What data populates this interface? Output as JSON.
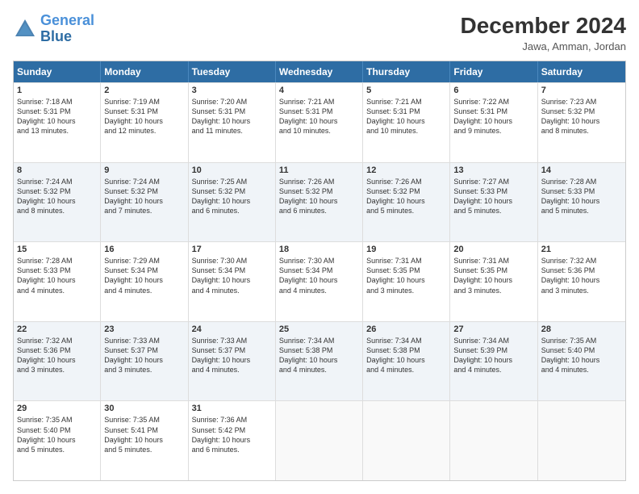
{
  "header": {
    "logo_line1": "General",
    "logo_line2": "Blue",
    "month_title": "December 2024",
    "location": "Jawa, Amman, Jordan"
  },
  "weekdays": [
    "Sunday",
    "Monday",
    "Tuesday",
    "Wednesday",
    "Thursday",
    "Friday",
    "Saturday"
  ],
  "rows": [
    [
      {
        "day": "1",
        "lines": [
          "Sunrise: 7:18 AM",
          "Sunset: 5:31 PM",
          "Daylight: 10 hours",
          "and 13 minutes."
        ]
      },
      {
        "day": "2",
        "lines": [
          "Sunrise: 7:19 AM",
          "Sunset: 5:31 PM",
          "Daylight: 10 hours",
          "and 12 minutes."
        ]
      },
      {
        "day": "3",
        "lines": [
          "Sunrise: 7:20 AM",
          "Sunset: 5:31 PM",
          "Daylight: 10 hours",
          "and 11 minutes."
        ]
      },
      {
        "day": "4",
        "lines": [
          "Sunrise: 7:21 AM",
          "Sunset: 5:31 PM",
          "Daylight: 10 hours",
          "and 10 minutes."
        ]
      },
      {
        "day": "5",
        "lines": [
          "Sunrise: 7:21 AM",
          "Sunset: 5:31 PM",
          "Daylight: 10 hours",
          "and 10 minutes."
        ]
      },
      {
        "day": "6",
        "lines": [
          "Sunrise: 7:22 AM",
          "Sunset: 5:31 PM",
          "Daylight: 10 hours",
          "and 9 minutes."
        ]
      },
      {
        "day": "7",
        "lines": [
          "Sunrise: 7:23 AM",
          "Sunset: 5:32 PM",
          "Daylight: 10 hours",
          "and 8 minutes."
        ]
      }
    ],
    [
      {
        "day": "8",
        "lines": [
          "Sunrise: 7:24 AM",
          "Sunset: 5:32 PM",
          "Daylight: 10 hours",
          "and 8 minutes."
        ]
      },
      {
        "day": "9",
        "lines": [
          "Sunrise: 7:24 AM",
          "Sunset: 5:32 PM",
          "Daylight: 10 hours",
          "and 7 minutes."
        ]
      },
      {
        "day": "10",
        "lines": [
          "Sunrise: 7:25 AM",
          "Sunset: 5:32 PM",
          "Daylight: 10 hours",
          "and 6 minutes."
        ]
      },
      {
        "day": "11",
        "lines": [
          "Sunrise: 7:26 AM",
          "Sunset: 5:32 PM",
          "Daylight: 10 hours",
          "and 6 minutes."
        ]
      },
      {
        "day": "12",
        "lines": [
          "Sunrise: 7:26 AM",
          "Sunset: 5:32 PM",
          "Daylight: 10 hours",
          "and 5 minutes."
        ]
      },
      {
        "day": "13",
        "lines": [
          "Sunrise: 7:27 AM",
          "Sunset: 5:33 PM",
          "Daylight: 10 hours",
          "and 5 minutes."
        ]
      },
      {
        "day": "14",
        "lines": [
          "Sunrise: 7:28 AM",
          "Sunset: 5:33 PM",
          "Daylight: 10 hours",
          "and 5 minutes."
        ]
      }
    ],
    [
      {
        "day": "15",
        "lines": [
          "Sunrise: 7:28 AM",
          "Sunset: 5:33 PM",
          "Daylight: 10 hours",
          "and 4 minutes."
        ]
      },
      {
        "day": "16",
        "lines": [
          "Sunrise: 7:29 AM",
          "Sunset: 5:34 PM",
          "Daylight: 10 hours",
          "and 4 minutes."
        ]
      },
      {
        "day": "17",
        "lines": [
          "Sunrise: 7:30 AM",
          "Sunset: 5:34 PM",
          "Daylight: 10 hours",
          "and 4 minutes."
        ]
      },
      {
        "day": "18",
        "lines": [
          "Sunrise: 7:30 AM",
          "Sunset: 5:34 PM",
          "Daylight: 10 hours",
          "and 4 minutes."
        ]
      },
      {
        "day": "19",
        "lines": [
          "Sunrise: 7:31 AM",
          "Sunset: 5:35 PM",
          "Daylight: 10 hours",
          "and 3 minutes."
        ]
      },
      {
        "day": "20",
        "lines": [
          "Sunrise: 7:31 AM",
          "Sunset: 5:35 PM",
          "Daylight: 10 hours",
          "and 3 minutes."
        ]
      },
      {
        "day": "21",
        "lines": [
          "Sunrise: 7:32 AM",
          "Sunset: 5:36 PM",
          "Daylight: 10 hours",
          "and 3 minutes."
        ]
      }
    ],
    [
      {
        "day": "22",
        "lines": [
          "Sunrise: 7:32 AM",
          "Sunset: 5:36 PM",
          "Daylight: 10 hours",
          "and 3 minutes."
        ]
      },
      {
        "day": "23",
        "lines": [
          "Sunrise: 7:33 AM",
          "Sunset: 5:37 PM",
          "Daylight: 10 hours",
          "and 3 minutes."
        ]
      },
      {
        "day": "24",
        "lines": [
          "Sunrise: 7:33 AM",
          "Sunset: 5:37 PM",
          "Daylight: 10 hours",
          "and 4 minutes."
        ]
      },
      {
        "day": "25",
        "lines": [
          "Sunrise: 7:34 AM",
          "Sunset: 5:38 PM",
          "Daylight: 10 hours",
          "and 4 minutes."
        ]
      },
      {
        "day": "26",
        "lines": [
          "Sunrise: 7:34 AM",
          "Sunset: 5:38 PM",
          "Daylight: 10 hours",
          "and 4 minutes."
        ]
      },
      {
        "day": "27",
        "lines": [
          "Sunrise: 7:34 AM",
          "Sunset: 5:39 PM",
          "Daylight: 10 hours",
          "and 4 minutes."
        ]
      },
      {
        "day": "28",
        "lines": [
          "Sunrise: 7:35 AM",
          "Sunset: 5:40 PM",
          "Daylight: 10 hours",
          "and 4 minutes."
        ]
      }
    ],
    [
      {
        "day": "29",
        "lines": [
          "Sunrise: 7:35 AM",
          "Sunset: 5:40 PM",
          "Daylight: 10 hours",
          "and 5 minutes."
        ]
      },
      {
        "day": "30",
        "lines": [
          "Sunrise: 7:35 AM",
          "Sunset: 5:41 PM",
          "Daylight: 10 hours",
          "and 5 minutes."
        ]
      },
      {
        "day": "31",
        "lines": [
          "Sunrise: 7:36 AM",
          "Sunset: 5:42 PM",
          "Daylight: 10 hours",
          "and 6 minutes."
        ]
      },
      {
        "day": "",
        "lines": []
      },
      {
        "day": "",
        "lines": []
      },
      {
        "day": "",
        "lines": []
      },
      {
        "day": "",
        "lines": []
      }
    ]
  ]
}
